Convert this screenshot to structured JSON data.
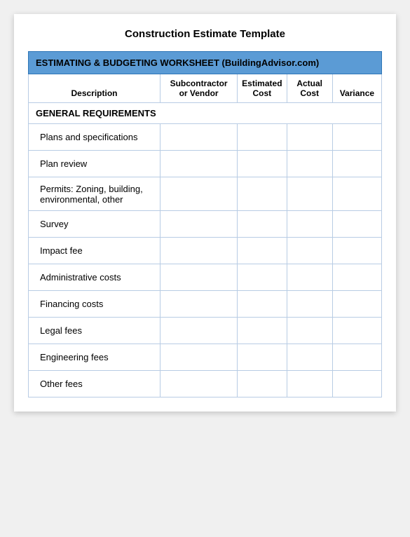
{
  "page": {
    "title": "Construction Estimate Template",
    "worksheet_header": "ESTIMATING & BUDGETING  WORKSHEET   (BuildingAdvisor.com)",
    "columns": {
      "description": "Description",
      "subcontractor": "Subcontractor or Vendor",
      "estimated_cost": "Estimated Cost",
      "actual_cost": "Actual Cost",
      "variance": "Variance"
    },
    "section_header": "GENERAL REQUIREMENTS",
    "rows": [
      "Plans and specifications",
      "Plan review",
      "Permits:  Zoning, building, environmental, other",
      "Survey",
      "Impact fee",
      "Administrative costs",
      "Financing costs",
      "Legal fees",
      "Engineering fees",
      "Other fees"
    ]
  }
}
